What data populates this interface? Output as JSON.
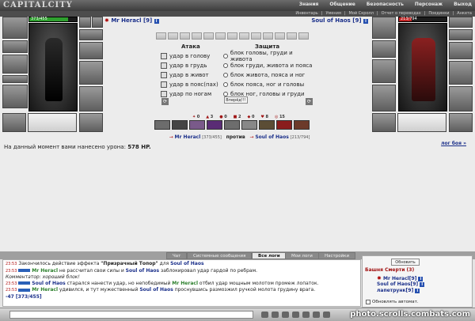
{
  "app": {
    "logo": "CAPITALCITY"
  },
  "topnav": [
    "Знания",
    "Общение",
    "Безопасность",
    "Персонаж",
    "Выход"
  ],
  "subnav": [
    "Инвентарь",
    "Умения",
    "Мой Скролл",
    "Отчет о переводах",
    "Поединки",
    "Анкета"
  ],
  "players": {
    "left": {
      "name": "Mr Heracl",
      "level": "[9]",
      "hp": "373/455",
      "hp_fraction": 0.82
    },
    "right": {
      "name": "Soul of Haos",
      "level": "[9]",
      "hp": "213/794",
      "hp_fraction": 0.27
    }
  },
  "combat": {
    "attack_header": "Атака",
    "defense_header": "Защита",
    "attacks": [
      "удар в голову",
      "удар в грудь",
      "удар в живот",
      "удар в пояс(пах)",
      "удар по ногам"
    ],
    "defenses": [
      "блок головы, груди и живота",
      "блок груди, живота и пояса",
      "блок живота, пояса и ног",
      "блок пояса, ног и головы",
      "блок ног, головы и груди"
    ],
    "forward_button": "Вперёд!!!"
  },
  "stats": [
    "0",
    "3",
    "0",
    "2",
    "0",
    "8",
    "15"
  ],
  "versus": {
    "left_name": "Mr Heracl",
    "left_hp": "[373/455]",
    "word": "против",
    "right_name": "Soul of Haos",
    "right_hp": "[213/794]"
  },
  "damage": {
    "prefix": "На данный момент вами нанесено урона:",
    "value": "578 HP."
  },
  "battle_log_link": "лог боя »",
  "tabs": [
    "Чат",
    "Системные сообщения",
    "Все логи",
    "Мои логи",
    "Настройки"
  ],
  "active_tab": "Все логи",
  "chat": [
    {
      "time": "23:53",
      "pre": "Закончилось действие эффекта ",
      "bold": "\"Призрачный Топор\"",
      "mid": " для ",
      "name": "Soul of Haos",
      "post": ""
    },
    {
      "time": "23:53",
      "name": "Mr Heracl",
      "text": " не рассчитал свои силы и ",
      "name2": "Soul of Haos",
      "post": " заблокировал удар гардой по ребрам."
    },
    {
      "comment": "Комментатор: хороший блок!"
    },
    {
      "time": "23:53",
      "name": "Soul of Haos",
      "text": " старался нанести удар, но непобедимый ",
      "name2": "Mr Heracl",
      "post": " отбил удар мощным молотом промеж лопаток."
    },
    {
      "time": "23:53",
      "name": "Mr Heracl",
      "text": " удивился, и тут мужественный ",
      "name2": "Soul of Haos",
      "post": " проснувшись размозжил ручкой молота грудину врага."
    },
    {
      "tail": "-47 [373/455]"
    }
  ],
  "roster": {
    "refresh_button": "Обновить",
    "location": "Башня Смерти (3)",
    "members": [
      "Mr Heracl[9]",
      "Soul of Haos[9]",
      "лапетрунк[9]"
    ],
    "auto_refresh_label": "Обновлять автомат."
  },
  "watermark": "photo.scrolls.combats.com"
}
